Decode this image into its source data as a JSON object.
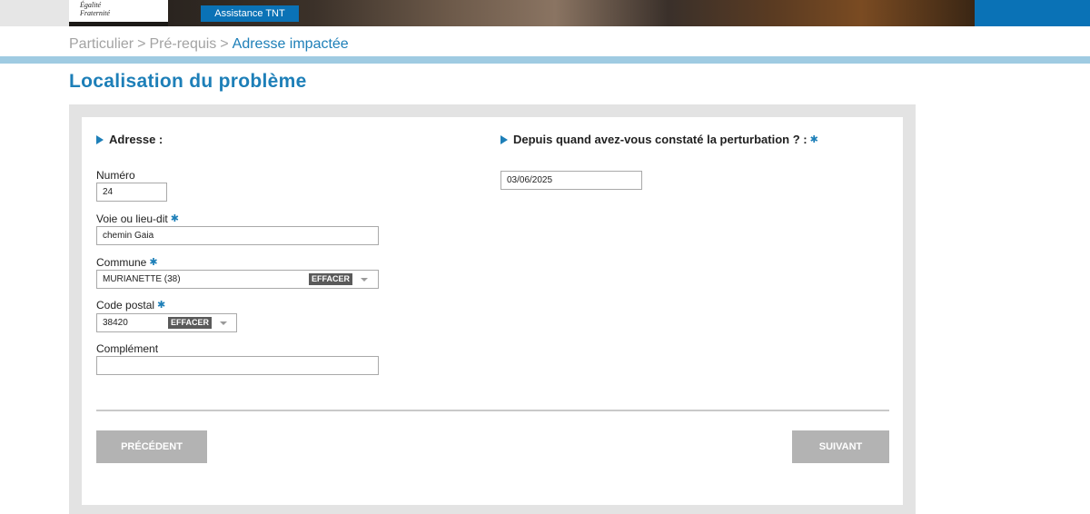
{
  "banner": {
    "logo_lines": "Égalité\nFraternité",
    "tab_label": "Assistance TNT"
  },
  "breadcrumb": {
    "items": [
      "Particulier",
      "Pré-requis",
      "Adresse impactée"
    ],
    "separator": ">"
  },
  "page": {
    "title": "Localisation du problème"
  },
  "address_section": {
    "heading": "Adresse :",
    "numero": {
      "label": "Numéro",
      "value": "24"
    },
    "voie": {
      "label": "Voie ou lieu-dit",
      "value": "chemin Gaia",
      "required": "✱"
    },
    "commune": {
      "label": "Commune",
      "value": "MURIANETTE (38)",
      "clear_label": "EFFACER",
      "required": "✱"
    },
    "code_postal": {
      "label": "Code postal",
      "value": "38420",
      "clear_label": "EFFACER",
      "required": "✱"
    },
    "complement": {
      "label": "Complément",
      "value": ""
    }
  },
  "date_section": {
    "heading": "Depuis quand avez-vous constaté la perturbation ? :",
    "required": "✱",
    "value": "03/06/2025"
  },
  "buttons": {
    "previous": "PRÉCÉDENT",
    "next": "SUIVANT"
  },
  "colors": {
    "accent": "#1d7fb8",
    "brand_blue": "#0a72b6",
    "button_gray": "#b3b3b3",
    "panel_gray": "#e3e3e3"
  }
}
